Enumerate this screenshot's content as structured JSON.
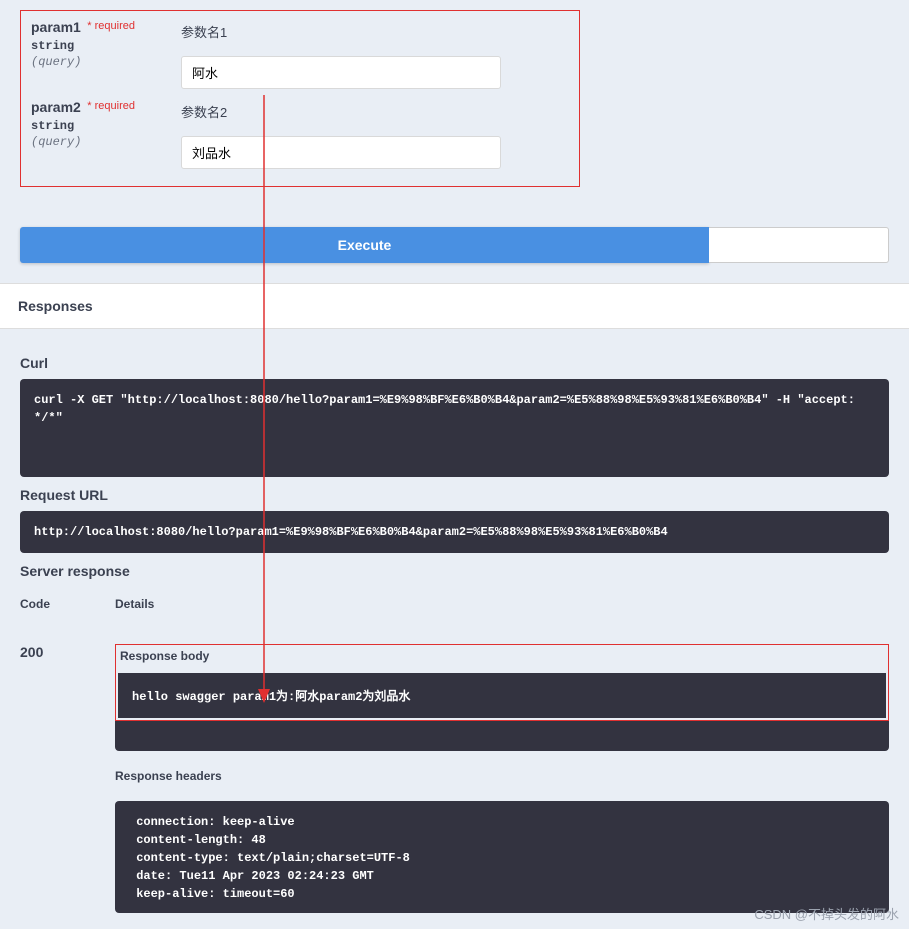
{
  "params": [
    {
      "name": "param1",
      "required_label": "* required",
      "type": "string",
      "in": "(query)",
      "description": "参数名1",
      "value": "阿水"
    },
    {
      "name": "param2",
      "required_label": "* required",
      "type": "string",
      "in": "(query)",
      "description": "参数名2",
      "value": "刘品水"
    }
  ],
  "buttons": {
    "execute": "Execute"
  },
  "responses_section_title": "Responses",
  "labels": {
    "curl": "Curl",
    "request_url": "Request URL",
    "server_response": "Server response",
    "code": "Code",
    "details": "Details",
    "response_body": "Response body",
    "response_headers": "Response headers"
  },
  "curl_command": "curl -X GET \"http://localhost:8080/hello?param1=%E9%98%BF%E6%B0%B4&param2=%E5%88%98%E5%93%81%E6%B0%B4\" -H \"accept: */*\"",
  "request_url": "http://localhost:8080/hello?param1=%E9%98%BF%E6%B0%B4&param2=%E5%88%98%E5%93%81%E6%B0%B4",
  "response": {
    "code": "200",
    "body": "hello swagger param1为:阿水param2为刘品水",
    "headers": " connection: keep-alive \n content-length: 48 \n content-type: text/plain;charset=UTF-8 \n date: Tue11 Apr 2023 02:24:23 GMT \n keep-alive: timeout=60 "
  },
  "watermark": "CSDN @不掉头发的阿水"
}
